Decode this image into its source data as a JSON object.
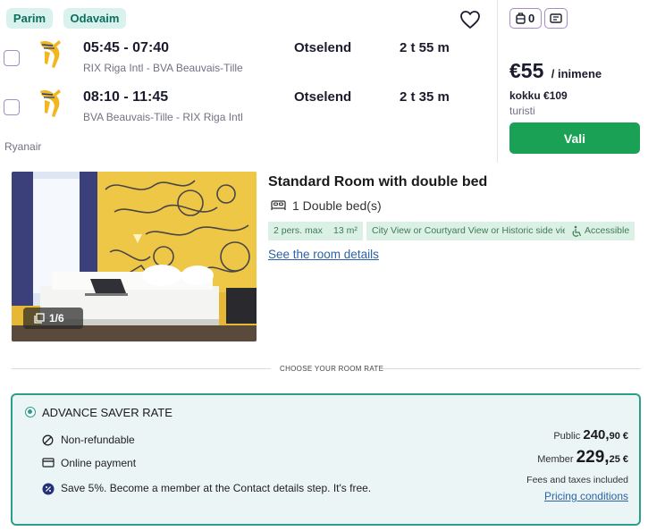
{
  "flight": {
    "tags": {
      "best": "Parim",
      "cheapest": "Odavaim"
    },
    "legs": [
      {
        "times": "05:45 - 07:40",
        "route": "RIX Riga Intl - BVA Beauvais-Tille",
        "type": "Otselend",
        "duration": "2 t 55 m"
      },
      {
        "times": "08:10 - 11:45",
        "route": "BVA Beauvais-Tille - RIX Riga Intl",
        "type": "Otselend",
        "duration": "2 t 35 m"
      }
    ],
    "airline": "Ryanair",
    "cabin_bag_count": "0",
    "price": "€55",
    "price_unit": "/ inimene",
    "total": "kokku €109",
    "fare_class": "turisti",
    "select_label": "Vali",
    "accent_color": "#1aa155"
  },
  "room": {
    "title": "Standard Room with double bed",
    "bed": "1 Double bed(s)",
    "photo_counter": "1/6",
    "features": [
      "2 pers. max",
      "13 m²",
      "City View or Courtyard View or Historic side view",
      "Accessible"
    ],
    "details_link": "See the room details",
    "rate_heading": "CHOOSE YOUR ROOM RATE"
  },
  "rate": {
    "name": "ADVANCE SAVER RATE",
    "conditions": [
      "Non-refundable",
      "Online payment"
    ],
    "promo": "Save 5%. Become a member at the Contact details step. It's free.",
    "public_label": "Public",
    "public_price_main": "240,",
    "public_price_cents": "90 €",
    "member_label": "Member",
    "member_price_main": "229,",
    "member_price_cents": "25 €",
    "fees": "Fees and taxes included",
    "pricing_link": "Pricing conditions",
    "border_color": "#2c9e8c"
  }
}
